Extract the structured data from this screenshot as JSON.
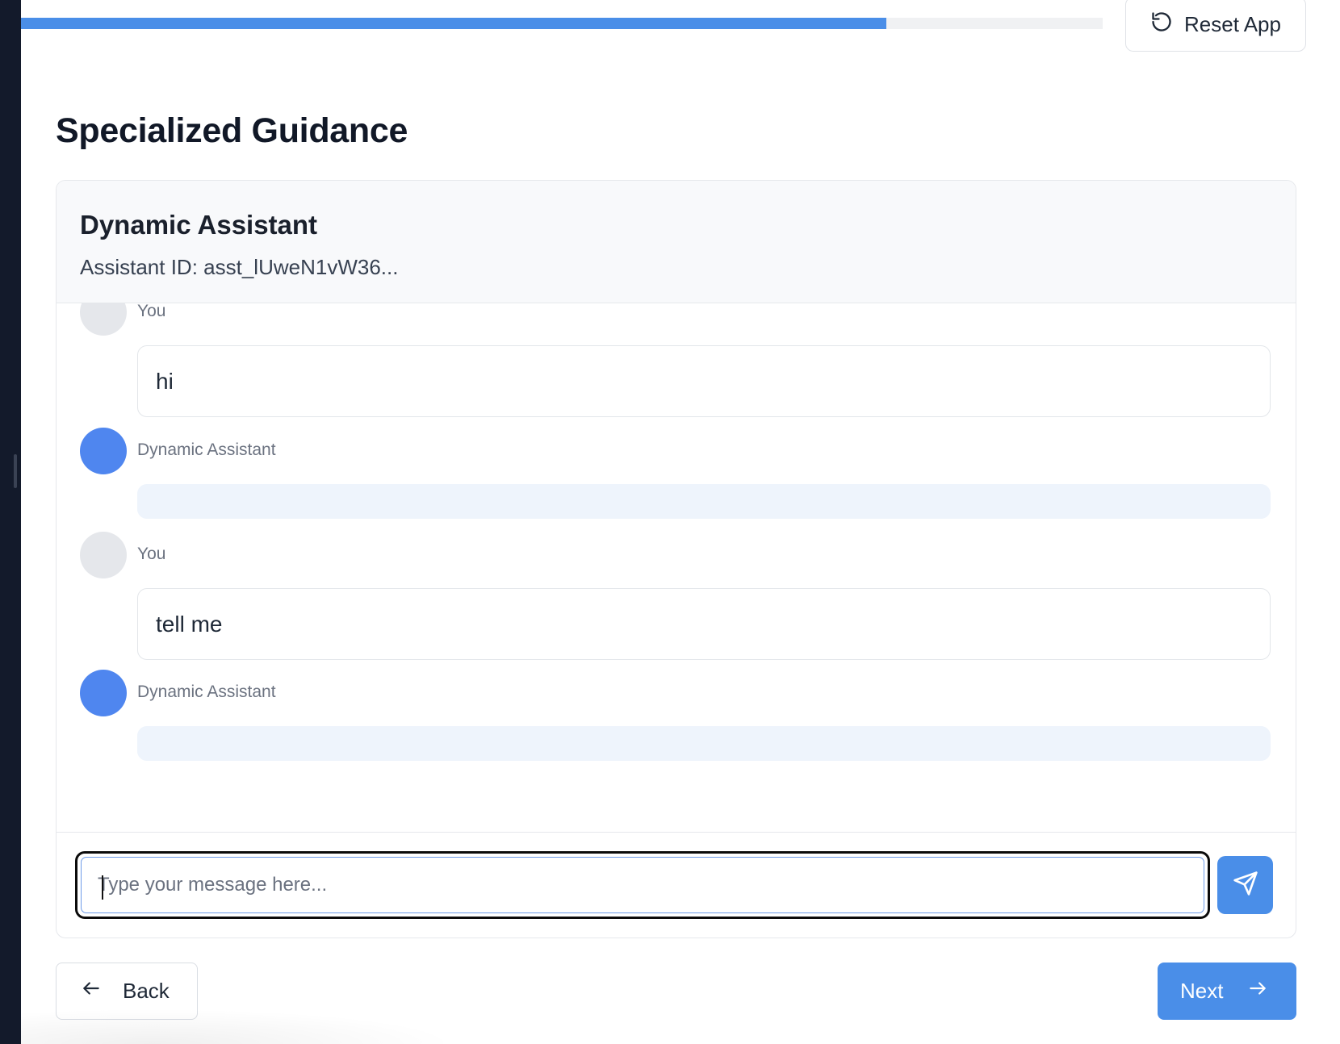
{
  "progress": {
    "fraction": 0.8
  },
  "header": {
    "reset_label": "Reset App"
  },
  "page": {
    "title": "Specialized Guidance"
  },
  "assistant": {
    "name": "Dynamic Assistant",
    "id_text": "Assistant ID: asst_lUweN1vW36..."
  },
  "messages": [
    {
      "role": "user",
      "sender": "You",
      "text": "hi"
    },
    {
      "role": "assistant",
      "sender": "Dynamic Assistant",
      "text": ""
    },
    {
      "role": "user",
      "sender": "You",
      "text": "tell me"
    },
    {
      "role": "assistant",
      "sender": "Dynamic Assistant",
      "text": ""
    }
  ],
  "composer": {
    "placeholder": "Type your message here...",
    "value": ""
  },
  "nav": {
    "back_label": "Back",
    "next_label": "Next"
  },
  "colors": {
    "accent": "#4a8ee8",
    "assistant_avatar": "#4f86ef",
    "user_avatar": "#e5e7eb"
  }
}
